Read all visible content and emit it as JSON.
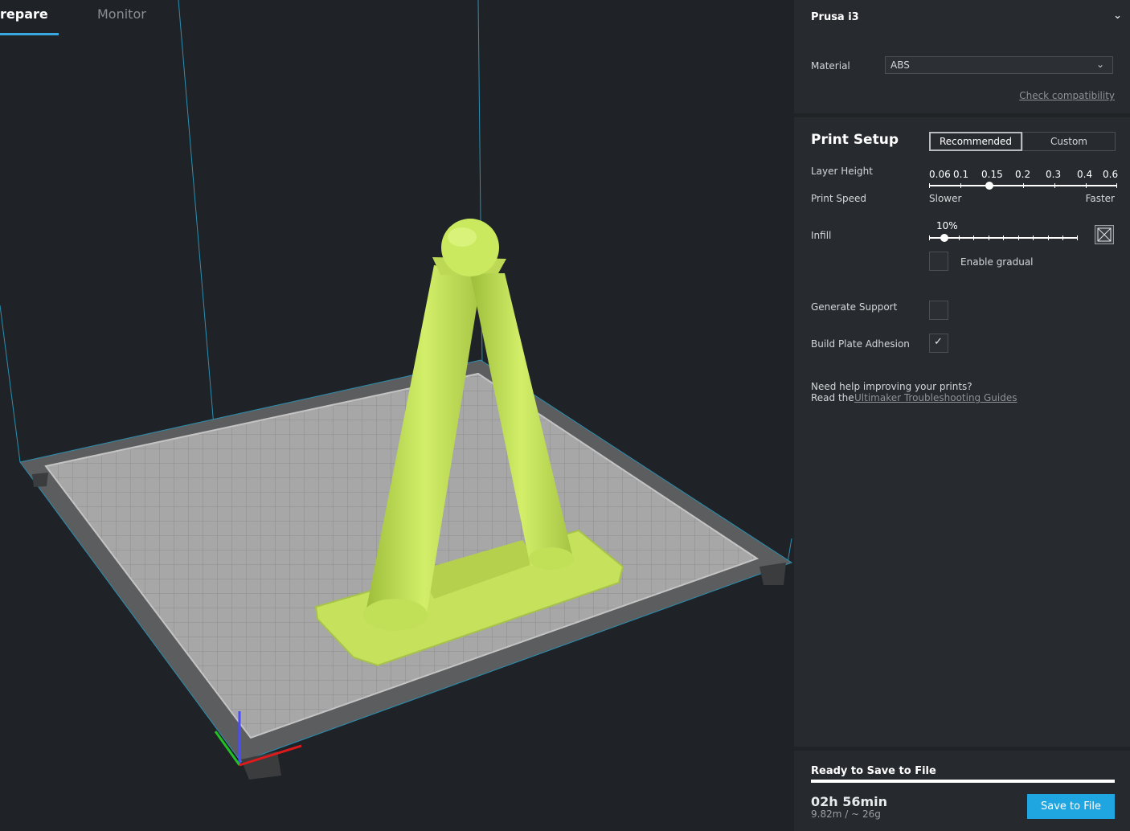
{
  "tabs": {
    "prepare": "repare",
    "monitor": "Monitor"
  },
  "printer": {
    "name": "Prusa i3"
  },
  "material": {
    "label": "Material",
    "value": "ABS",
    "check_link": "Check compatibility"
  },
  "print_setup": {
    "title": "Print Setup",
    "mode_recommended": "Recommended",
    "mode_custom": "Custom",
    "layer_height_label": "Layer Height",
    "layer_heights": [
      "0.06",
      "0.1",
      "0.15",
      "0.2",
      "0.3",
      "0.4",
      "0.6"
    ],
    "layer_height_selected": "0.15",
    "print_speed_label": "Print Speed",
    "speed_slower": "Slower",
    "speed_faster": "Faster",
    "infill_label": "Infill",
    "infill_value": "10%",
    "infill_fraction": 0.1,
    "enable_gradual_label": "Enable gradual",
    "enable_gradual_checked": false,
    "generate_support_label": "Generate Support",
    "generate_support_checked": false,
    "build_plate_adhesion_label": "Build Plate Adhesion",
    "build_plate_adhesion_checked": true,
    "help_line1": "Need help improving your prints?",
    "help_line2_prefix": "Read the ",
    "help_link": "Ultimaker Troubleshooting Guides"
  },
  "output": {
    "status": "Ready to Save to File",
    "progress": 1.0,
    "time": "02h 56min",
    "usage": "9.82m / ~ 26g",
    "save_button": "Save to File"
  },
  "colors": {
    "accent": "#1fa5e0",
    "model": "#c8e65a",
    "build_plate": "#9b9b9b"
  }
}
